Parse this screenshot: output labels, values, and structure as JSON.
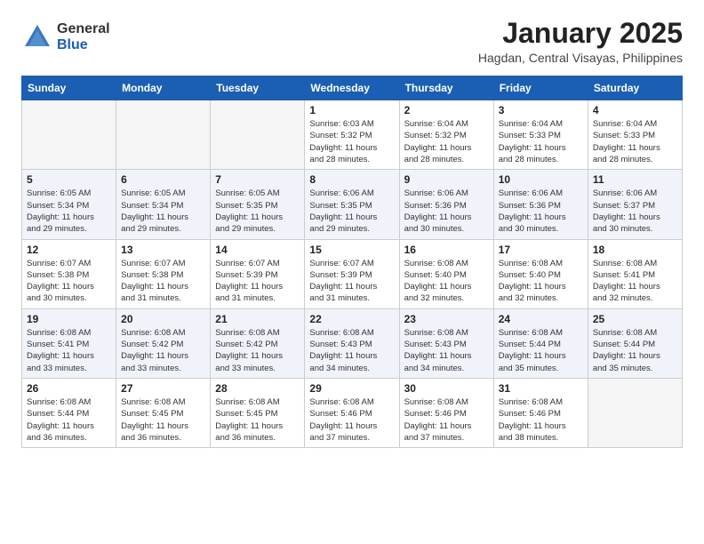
{
  "header": {
    "logo_general": "General",
    "logo_blue": "Blue",
    "month_title": "January 2025",
    "subtitle": "Hagdan, Central Visayas, Philippines"
  },
  "days_of_week": [
    "Sunday",
    "Monday",
    "Tuesday",
    "Wednesday",
    "Thursday",
    "Friday",
    "Saturday"
  ],
  "weeks": [
    [
      {
        "day": "",
        "info": ""
      },
      {
        "day": "",
        "info": ""
      },
      {
        "day": "",
        "info": ""
      },
      {
        "day": "1",
        "info": "Sunrise: 6:03 AM\nSunset: 5:32 PM\nDaylight: 11 hours\nand 28 minutes."
      },
      {
        "day": "2",
        "info": "Sunrise: 6:04 AM\nSunset: 5:32 PM\nDaylight: 11 hours\nand 28 minutes."
      },
      {
        "day": "3",
        "info": "Sunrise: 6:04 AM\nSunset: 5:33 PM\nDaylight: 11 hours\nand 28 minutes."
      },
      {
        "day": "4",
        "info": "Sunrise: 6:04 AM\nSunset: 5:33 PM\nDaylight: 11 hours\nand 28 minutes."
      }
    ],
    [
      {
        "day": "5",
        "info": "Sunrise: 6:05 AM\nSunset: 5:34 PM\nDaylight: 11 hours\nand 29 minutes."
      },
      {
        "day": "6",
        "info": "Sunrise: 6:05 AM\nSunset: 5:34 PM\nDaylight: 11 hours\nand 29 minutes."
      },
      {
        "day": "7",
        "info": "Sunrise: 6:05 AM\nSunset: 5:35 PM\nDaylight: 11 hours\nand 29 minutes."
      },
      {
        "day": "8",
        "info": "Sunrise: 6:06 AM\nSunset: 5:35 PM\nDaylight: 11 hours\nand 29 minutes."
      },
      {
        "day": "9",
        "info": "Sunrise: 6:06 AM\nSunset: 5:36 PM\nDaylight: 11 hours\nand 30 minutes."
      },
      {
        "day": "10",
        "info": "Sunrise: 6:06 AM\nSunset: 5:36 PM\nDaylight: 11 hours\nand 30 minutes."
      },
      {
        "day": "11",
        "info": "Sunrise: 6:06 AM\nSunset: 5:37 PM\nDaylight: 11 hours\nand 30 minutes."
      }
    ],
    [
      {
        "day": "12",
        "info": "Sunrise: 6:07 AM\nSunset: 5:38 PM\nDaylight: 11 hours\nand 30 minutes."
      },
      {
        "day": "13",
        "info": "Sunrise: 6:07 AM\nSunset: 5:38 PM\nDaylight: 11 hours\nand 31 minutes."
      },
      {
        "day": "14",
        "info": "Sunrise: 6:07 AM\nSunset: 5:39 PM\nDaylight: 11 hours\nand 31 minutes."
      },
      {
        "day": "15",
        "info": "Sunrise: 6:07 AM\nSunset: 5:39 PM\nDaylight: 11 hours\nand 31 minutes."
      },
      {
        "day": "16",
        "info": "Sunrise: 6:08 AM\nSunset: 5:40 PM\nDaylight: 11 hours\nand 32 minutes."
      },
      {
        "day": "17",
        "info": "Sunrise: 6:08 AM\nSunset: 5:40 PM\nDaylight: 11 hours\nand 32 minutes."
      },
      {
        "day": "18",
        "info": "Sunrise: 6:08 AM\nSunset: 5:41 PM\nDaylight: 11 hours\nand 32 minutes."
      }
    ],
    [
      {
        "day": "19",
        "info": "Sunrise: 6:08 AM\nSunset: 5:41 PM\nDaylight: 11 hours\nand 33 minutes."
      },
      {
        "day": "20",
        "info": "Sunrise: 6:08 AM\nSunset: 5:42 PM\nDaylight: 11 hours\nand 33 minutes."
      },
      {
        "day": "21",
        "info": "Sunrise: 6:08 AM\nSunset: 5:42 PM\nDaylight: 11 hours\nand 33 minutes."
      },
      {
        "day": "22",
        "info": "Sunrise: 6:08 AM\nSunset: 5:43 PM\nDaylight: 11 hours\nand 34 minutes."
      },
      {
        "day": "23",
        "info": "Sunrise: 6:08 AM\nSunset: 5:43 PM\nDaylight: 11 hours\nand 34 minutes."
      },
      {
        "day": "24",
        "info": "Sunrise: 6:08 AM\nSunset: 5:44 PM\nDaylight: 11 hours\nand 35 minutes."
      },
      {
        "day": "25",
        "info": "Sunrise: 6:08 AM\nSunset: 5:44 PM\nDaylight: 11 hours\nand 35 minutes."
      }
    ],
    [
      {
        "day": "26",
        "info": "Sunrise: 6:08 AM\nSunset: 5:44 PM\nDaylight: 11 hours\nand 36 minutes."
      },
      {
        "day": "27",
        "info": "Sunrise: 6:08 AM\nSunset: 5:45 PM\nDaylight: 11 hours\nand 36 minutes."
      },
      {
        "day": "28",
        "info": "Sunrise: 6:08 AM\nSunset: 5:45 PM\nDaylight: 11 hours\nand 36 minutes."
      },
      {
        "day": "29",
        "info": "Sunrise: 6:08 AM\nSunset: 5:46 PM\nDaylight: 11 hours\nand 37 minutes."
      },
      {
        "day": "30",
        "info": "Sunrise: 6:08 AM\nSunset: 5:46 PM\nDaylight: 11 hours\nand 37 minutes."
      },
      {
        "day": "31",
        "info": "Sunrise: 6:08 AM\nSunset: 5:46 PM\nDaylight: 11 hours\nand 38 minutes."
      },
      {
        "day": "",
        "info": ""
      }
    ]
  ]
}
